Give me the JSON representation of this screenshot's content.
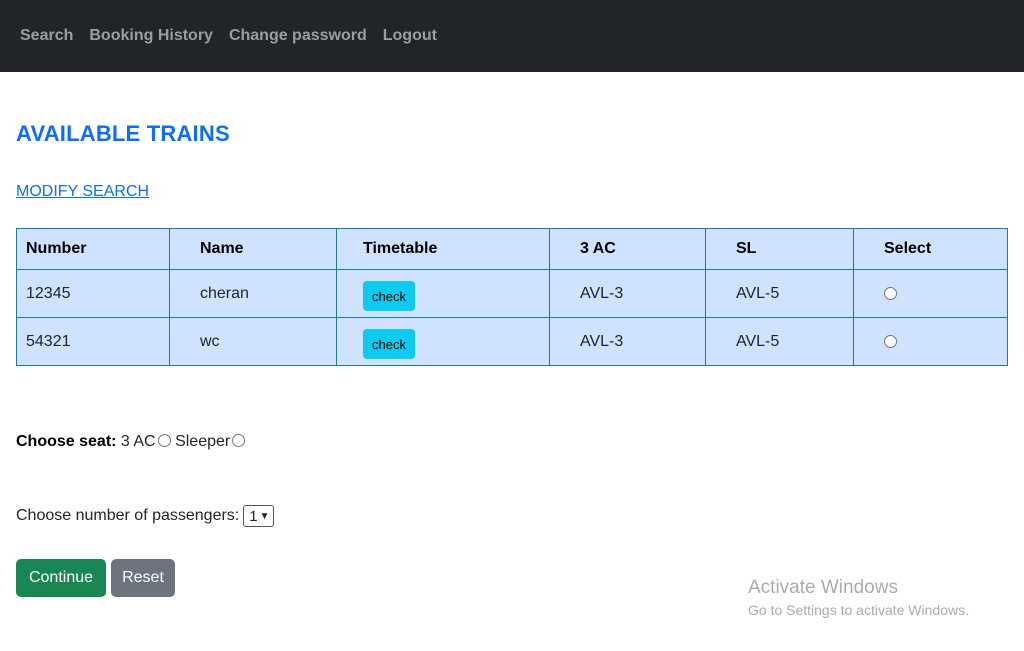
{
  "nav": {
    "items": [
      "Search",
      "Booking History",
      "Change password",
      "Logout"
    ]
  },
  "page": {
    "title": "AVAILABLE TRAINS",
    "modify_link": "MODIFY SEARCH"
  },
  "table": {
    "headers": [
      "Number",
      "Name",
      "Timetable",
      "3 AC",
      "SL",
      "Select"
    ],
    "rows": [
      {
        "number": "12345",
        "name": "cheran",
        "timetable_button": "check",
        "ac3": "AVL-3",
        "sl": "AVL-5",
        "selected": false
      },
      {
        "number": "54321",
        "name": "wc",
        "timetable_button": "check",
        "ac3": "AVL-3",
        "sl": "AVL-5",
        "selected": false
      }
    ]
  },
  "seat": {
    "label": "Choose seat:",
    "options": [
      "3 AC",
      "Sleeper"
    ]
  },
  "passengers": {
    "label": "Choose number of passengers:",
    "selected": "1"
  },
  "buttons": {
    "continue": "Continue",
    "reset": "Reset"
  },
  "watermark": {
    "title": "Activate Windows",
    "subtitle": "Go to Settings to activate Windows."
  },
  "colors": {
    "navbar_bg": "#212529",
    "accent": "#0d6efd",
    "table_bg": "#cfe2ff",
    "check_btn": "#0dcaf0",
    "continue_btn": "#198754",
    "reset_btn": "#6c757d"
  }
}
